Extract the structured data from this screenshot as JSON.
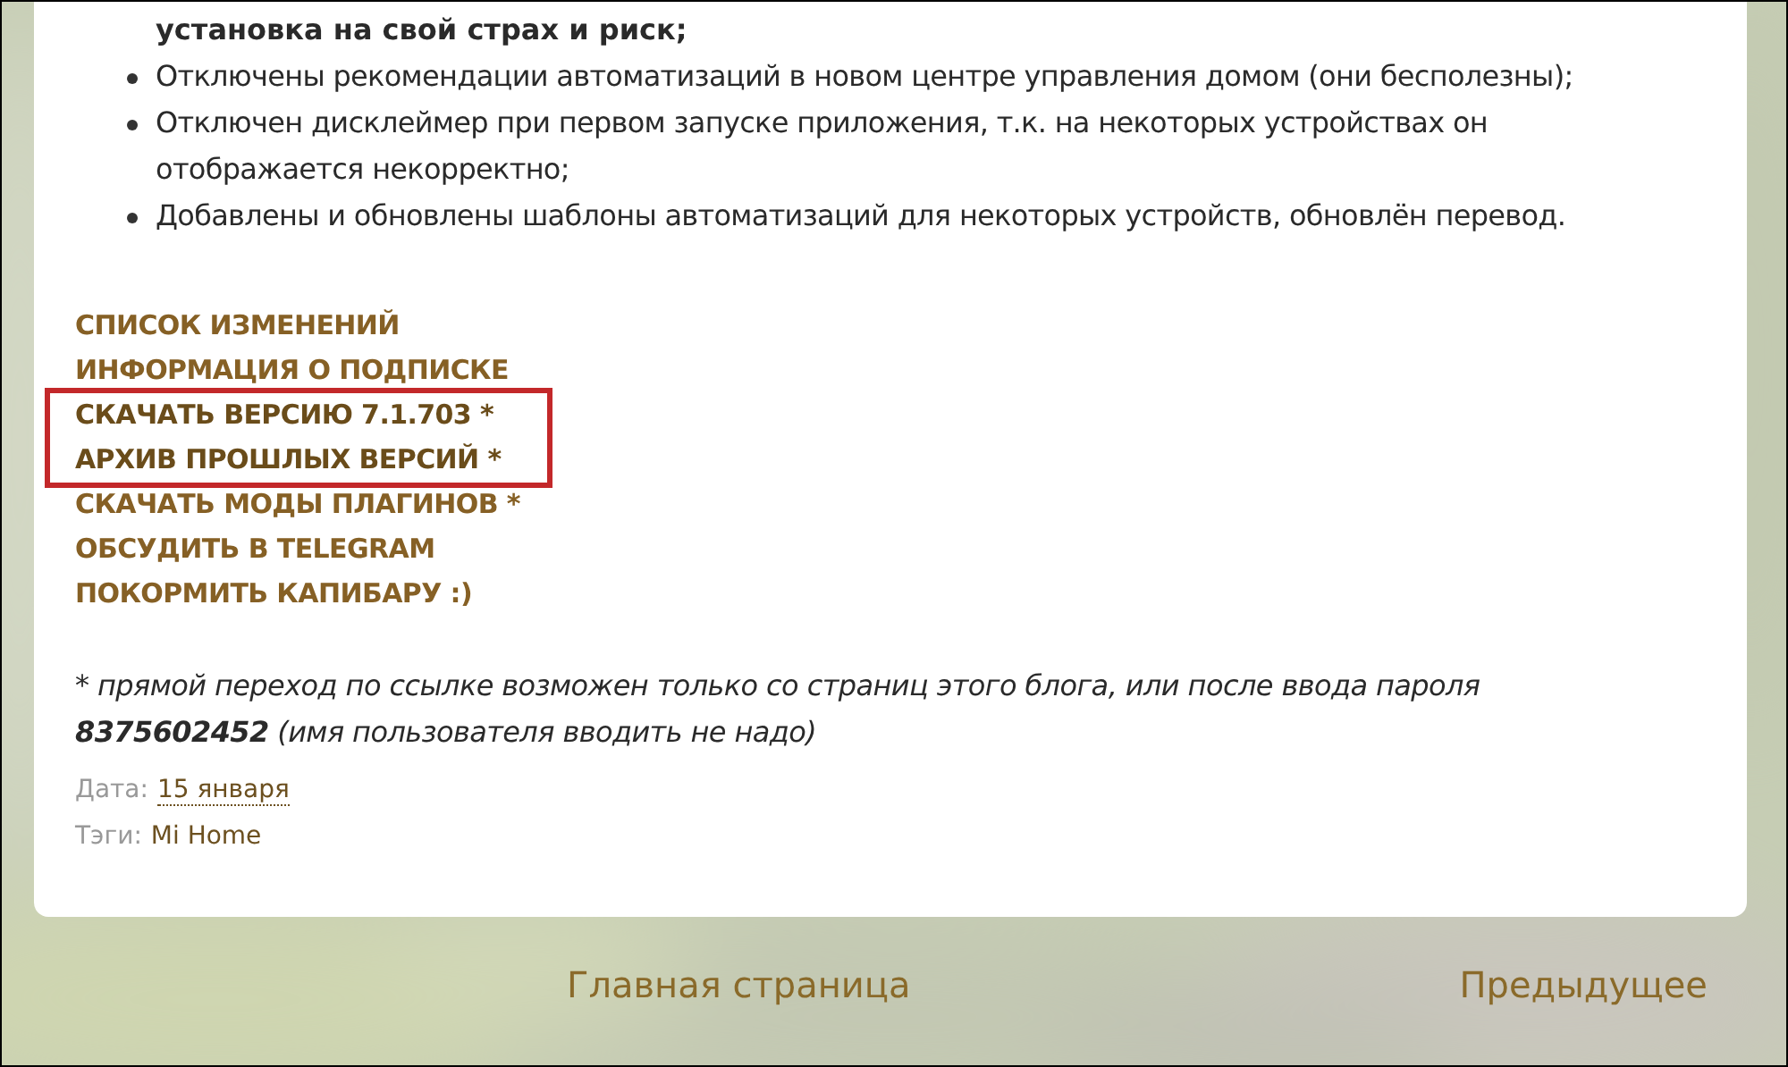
{
  "post": {
    "continuation": "установка на свой страх и риск;",
    "bullets": [
      "Отключены рекомендации автоматизаций в новом центре управления домом (они бесполезны);",
      "Отключен дисклеймер при первом запуске приложения, т.к. на некоторых устройствах он отображается некорректно;",
      "Добавлены и обновлены шаблоны автоматизаций для некоторых устройств, обновлён перевод."
    ],
    "links": [
      {
        "label": "СПИСОК ИЗМЕНЕНИЙ",
        "highlighted": false
      },
      {
        "label": "ИНФОРМАЦИЯ О ПОДПИСКЕ",
        "highlighted": false
      },
      {
        "label": "СКАЧАТЬ ВЕРСИЮ 7.1.703 *",
        "highlighted": true
      },
      {
        "label": "АРХИВ ПРОШЛЫХ ВЕРСИЙ *",
        "highlighted": true
      },
      {
        "label": "СКАЧАТЬ МОДЫ ПЛАГИНОВ *",
        "highlighted": false
      },
      {
        "label": "ОБСУДИТЬ В TELEGRAM",
        "highlighted": false
      },
      {
        "label": "ПОКОРМИТЬ КАПИБАРУ :)",
        "highlighted": false
      }
    ],
    "footnote": "* прямой переход по ссылке возможен только со страниц этого блога, или после ввода пароля **8375602452** (имя пользователя вводить не надо)",
    "date_label": "Дата:",
    "date": "15 января",
    "tags_label": "Тэги:",
    "tag": "Mi Home"
  },
  "pager": {
    "home": "Главная страница",
    "previous": "Предыдущее"
  }
}
